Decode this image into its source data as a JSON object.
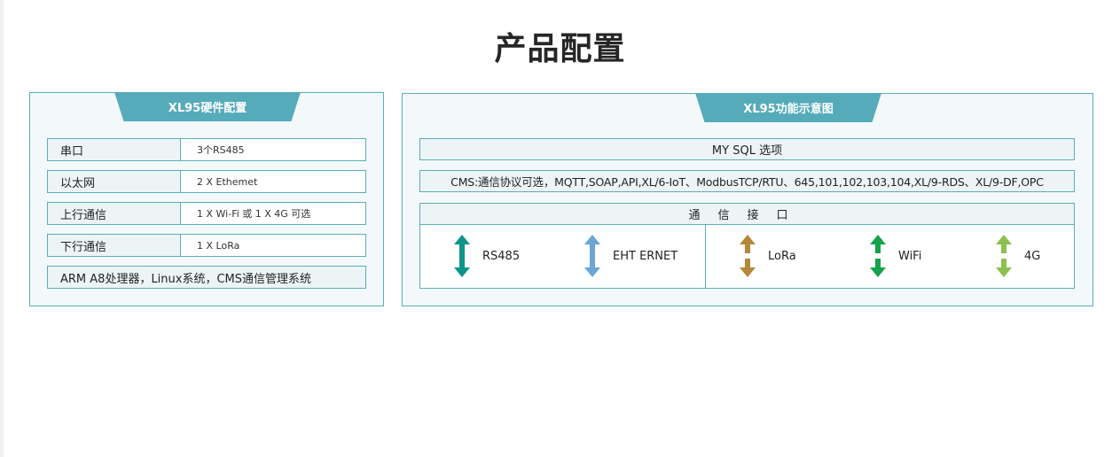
{
  "page": {
    "title": "产品配置"
  },
  "hardware": {
    "tab": "XL95硬件配置",
    "rows": [
      {
        "key": "串口",
        "value": "3个RS485"
      },
      {
        "key": "以太网",
        "value": "2 X Ethemet"
      },
      {
        "key": "上行通信",
        "value": "1 X Wi-Fi 或 1 X 4G 可选"
      },
      {
        "key": "下行通信",
        "value": "1 X LoRa"
      }
    ],
    "footer": "ARM A8处理器，Linux系统，CMS通信管理系统"
  },
  "function": {
    "tab": "XL95功能示意图",
    "mysql": "MY SQL 选项",
    "cms": "CMS:通信协议可选，MQTT,SOAP,API,XL/6-IoT、ModbusTCP/RTU、645,101,102,103,104,XL/9-RDS、XL/9-DF,OPC",
    "interface_header": "通信接口",
    "interfaces": [
      {
        "label": "RS485",
        "icon": "double-arrow-icon",
        "color": "#0d948a"
      },
      {
        "label": "EHT ERNET",
        "icon": "double-arrow-icon",
        "color": "#6aa6d6"
      },
      {
        "label": "LoRa",
        "icon": "double-arrow-icon",
        "color": "#b3883a"
      },
      {
        "label": "WiFi",
        "icon": "double-arrow-icon",
        "color": "#15a24a"
      },
      {
        "label": "4G",
        "icon": "double-arrow-icon",
        "color": "#8cc04f"
      }
    ]
  }
}
